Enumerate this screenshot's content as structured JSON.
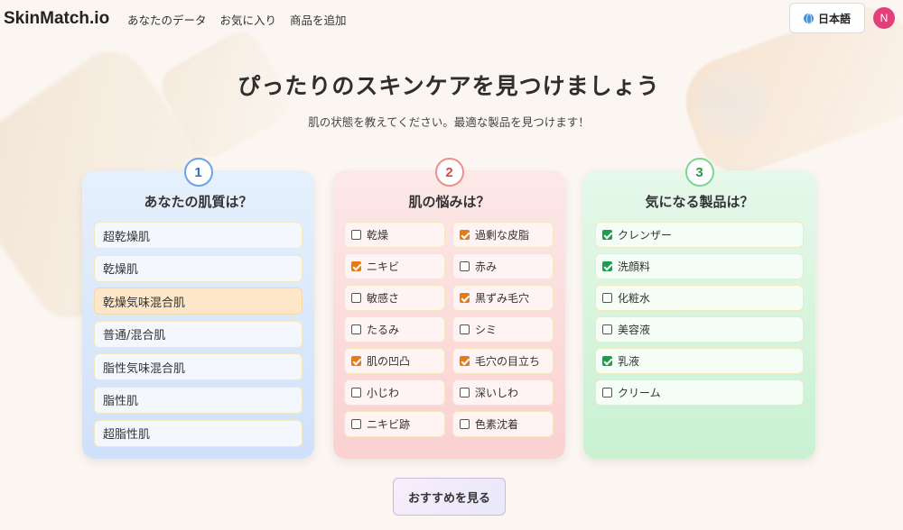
{
  "header": {
    "logo": "SkinMatch.io",
    "nav": [
      "あなたのデータ",
      "お気に入り",
      "商品を追加"
    ],
    "language": "日本語",
    "avatar_initial": "N"
  },
  "hero": {
    "title": "ぴったりのスキンケアを見つけましょう",
    "subtitle": "肌の状態を教えてください。最適な製品を見つけます！"
  },
  "steps": [
    {
      "number": "1",
      "title": "あなたの肌質は？",
      "options": [
        {
          "label": "超乾燥肌",
          "selected": false
        },
        {
          "label": "乾燥肌",
          "selected": false
        },
        {
          "label": "乾燥気味混合肌",
          "selected": true
        },
        {
          "label": "普通/混合肌",
          "selected": false
        },
        {
          "label": "脂性気味混合肌",
          "selected": false
        },
        {
          "label": "脂性肌",
          "selected": false
        },
        {
          "label": "超脂性肌",
          "selected": false
        }
      ]
    },
    {
      "number": "2",
      "title": "肌の悩みは？",
      "options": [
        {
          "label": "乾燥",
          "checked": false
        },
        {
          "label": "過剰な皮脂",
          "checked": true
        },
        {
          "label": "ニキビ",
          "checked": true
        },
        {
          "label": "赤み",
          "checked": false
        },
        {
          "label": "敏感さ",
          "checked": false
        },
        {
          "label": "黒ずみ毛穴",
          "checked": true
        },
        {
          "label": "たるみ",
          "checked": false
        },
        {
          "label": "シミ",
          "checked": false
        },
        {
          "label": "肌の凹凸",
          "checked": true
        },
        {
          "label": "毛穴の目立ち",
          "checked": true
        },
        {
          "label": "小じわ",
          "checked": false
        },
        {
          "label": "深いしわ",
          "checked": false
        },
        {
          "label": "ニキビ跡",
          "checked": false
        },
        {
          "label": "色素沈着",
          "checked": false
        }
      ]
    },
    {
      "number": "3",
      "title": "気になる製品は？",
      "options": [
        {
          "label": "クレンザー",
          "checked": true
        },
        {
          "label": "洗顔料",
          "checked": true
        },
        {
          "label": "化粧水",
          "checked": false
        },
        {
          "label": "美容液",
          "checked": false
        },
        {
          "label": "乳液",
          "checked": true
        },
        {
          "label": "クリーム",
          "checked": false
        }
      ]
    }
  ],
  "submit_label": "おすすめを見る",
  "colors": {
    "concern_check": "#e87a12",
    "product_check": "#1c9e4e",
    "avatar": "#e3407a",
    "selected_skin": "#fde7c8"
  }
}
